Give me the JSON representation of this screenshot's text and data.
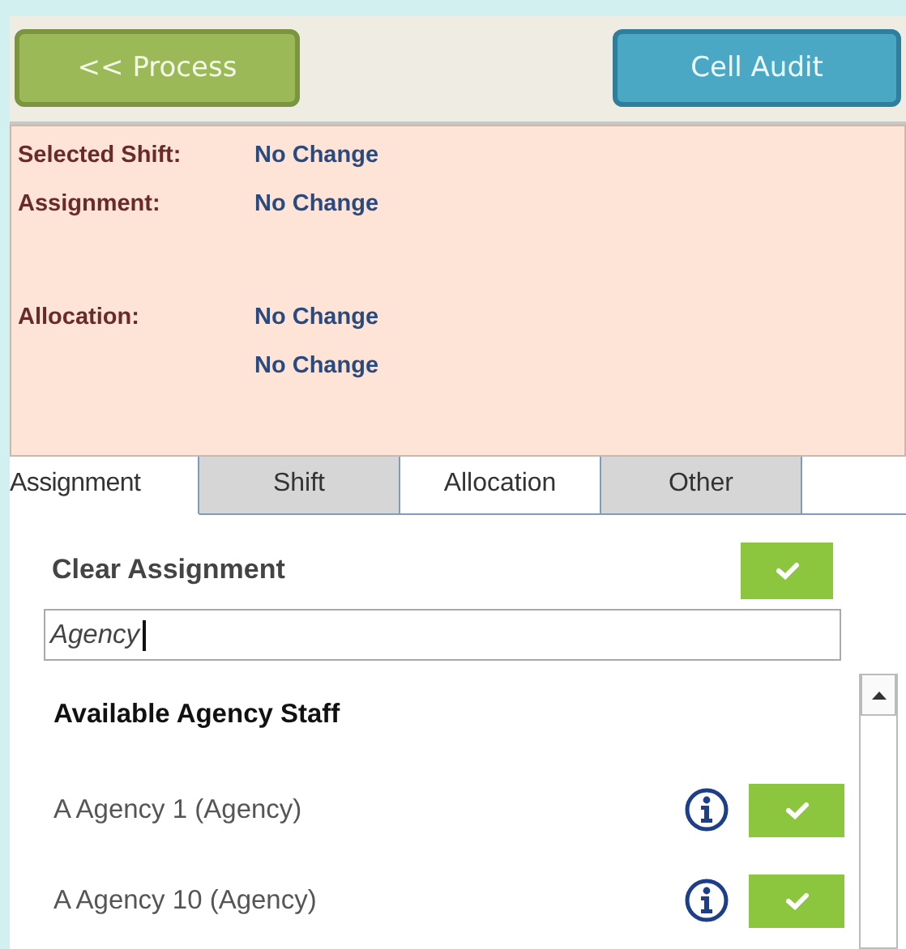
{
  "toolbar": {
    "buttons": [
      {
        "label": "<< Process",
        "kind": "back"
      },
      {
        "label": "Cell Audit",
        "kind": "audit"
      }
    ]
  },
  "summary": [
    {
      "label": "Selected Shift:",
      "value": "No Change"
    },
    {
      "label": "Assignment:",
      "value": "No Change"
    },
    {
      "label": "Allocation:",
      "value": "No Change"
    },
    {
      "value": "No Change"
    }
  ],
  "tabs": [
    {
      "label": "Assignment",
      "selected": true,
      "shaded": false
    },
    {
      "label": "Shift",
      "selected": false,
      "shaded": true
    },
    {
      "label": "Allocation",
      "selected": false,
      "shaded": false
    },
    {
      "label": "Other",
      "selected": false,
      "shaded": true
    }
  ],
  "clear_assignment": {
    "label": "Clear Assignment"
  },
  "search": {
    "value": "Agency"
  },
  "staff_list": {
    "heading": "Available Agency Staff",
    "items": [
      {
        "name": "A Agency 1 (Agency)"
      },
      {
        "name": "A Agency 10 (Agency)"
      }
    ]
  }
}
